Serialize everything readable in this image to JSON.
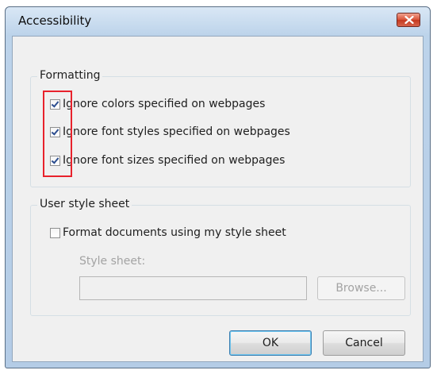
{
  "window": {
    "title": "Accessibility",
    "close_icon": "close-icon"
  },
  "formatting": {
    "label": "Formatting",
    "options": [
      {
        "label": "Ignore colors specified on webpages",
        "checked": true
      },
      {
        "label": "Ignore font styles specified on webpages",
        "checked": true
      },
      {
        "label": "Ignore font sizes specified on webpages",
        "checked": true
      }
    ]
  },
  "user_style_sheet": {
    "label": "User style sheet",
    "option_label": "Format documents using my style sheet",
    "option_checked": false,
    "style_sheet_label": "Style sheet:",
    "style_sheet_value": "",
    "browse_label": "Browse..."
  },
  "buttons": {
    "ok_label": "OK",
    "cancel_label": "Cancel"
  },
  "colors": {
    "highlight": "#e8222c",
    "title_bar": "#bcd3ea",
    "close_button": "#d9543a"
  }
}
